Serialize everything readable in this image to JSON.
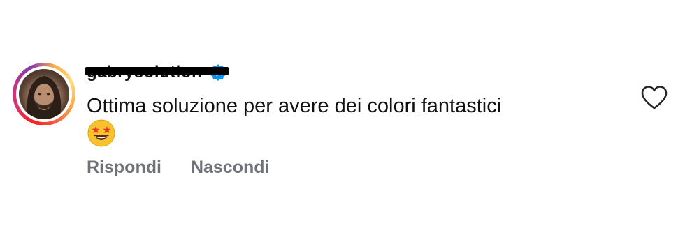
{
  "comment": {
    "username": "gabrysolution",
    "verified": true,
    "text": "Ottima soluzione per avere dei colori fantastici",
    "emoji": "star-struck",
    "actions": {
      "reply_label": "Rispondi",
      "hide_label": "Nascondi"
    }
  },
  "colors": {
    "text": "#111111",
    "secondary_text": "#6f7378",
    "verified_badge": "#0095f6",
    "like_outline": "#262626"
  }
}
